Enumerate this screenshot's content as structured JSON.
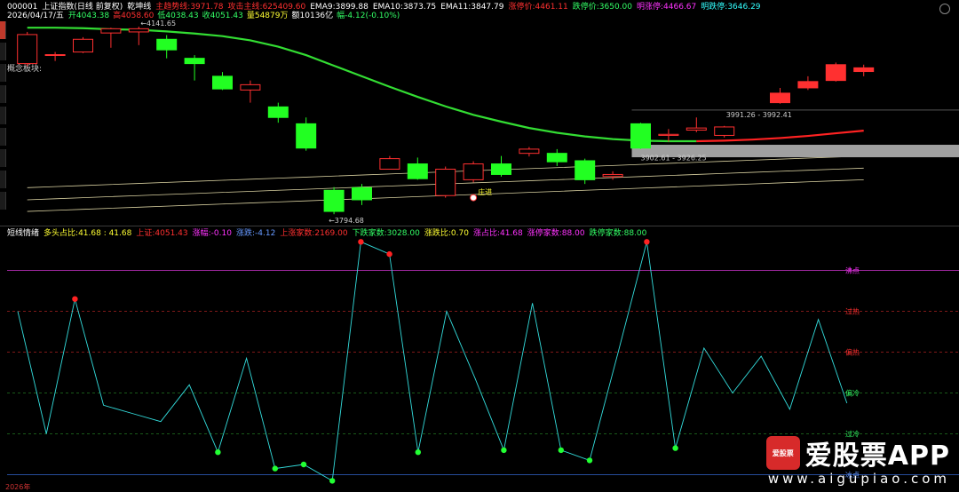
{
  "header": {
    "code": "000001",
    "name": "上证指数(日线 前复权)",
    "indicator": "乾坤线",
    "items": [
      {
        "label": "主趋势线:",
        "value": "3971.78",
        "color": "#ff3030"
      },
      {
        "label": "攻击主线:",
        "value": "625409.60",
        "color": "#ff3030"
      },
      {
        "label": "EMA9:",
        "value": "3899.88",
        "color": "#ffffff"
      },
      {
        "label": "EMA10:",
        "value": "3873.75",
        "color": "#ffffff"
      },
      {
        "label": "EMA11:",
        "value": "3847.79",
        "color": "#ffffff"
      },
      {
        "label": "涨停价:",
        "value": "4461.11",
        "color": "#ff3030"
      },
      {
        "label": "跌停价:",
        "value": "3650.00",
        "color": "#33ff66"
      },
      {
        "label": "明涨停:",
        "value": "4466.67",
        "color": "#ff33ff"
      },
      {
        "label": "明跌停:",
        "value": "3646.29",
        "color": "#33ffff"
      }
    ]
  },
  "info_line": {
    "date": "2026/04/17/五",
    "items": [
      {
        "label": "开",
        "value": "4043.38",
        "color": "#33ff66"
      },
      {
        "label": "高",
        "value": "4058.60",
        "color": "#ff3030"
      },
      {
        "label": "低",
        "value": "4038.43",
        "color": "#33ff66"
      },
      {
        "label": "收",
        "value": "4051.43",
        "color": "#33ff66"
      },
      {
        "label": "量",
        "value": "54879万",
        "color": "#ffff33"
      },
      {
        "label": "额",
        "value": "10136亿",
        "color": "#ffffff"
      },
      {
        "label": "幅",
        "value": "-4.12(-0.10%)",
        "color": "#33ff66"
      }
    ]
  },
  "main_chart": {
    "concept_label": "概念板块:",
    "annotations": {
      "high": "4141.65",
      "low": "3794.68",
      "zhuang": "庄进",
      "band_upper": "3991.26 - 3992.41",
      "band_lower": "3902.61 - 3926.25"
    },
    "colors": {
      "up": "#ff3030",
      "down": "#22ff22",
      "ma_green": "#33dd33",
      "ma_red": "#ff2222",
      "band": "#a0a0a0"
    }
  },
  "osc_header": {
    "title": "短线情绪",
    "items": [
      {
        "label": "多头占比:",
        "value": "41.68 : 41.68",
        "color": "#ffff33"
      },
      {
        "label": "上证:",
        "value": "4051.43",
        "color": "#ff3030"
      },
      {
        "label": "涨幅:",
        "value": "-0.10",
        "color": "#ff33ff"
      },
      {
        "label": "涨跌:",
        "value": "-4.12",
        "color": "#6699ff"
      },
      {
        "label": "上涨家数:",
        "value": "2169.00",
        "color": "#ff3030"
      },
      {
        "label": "下跌家数:",
        "value": "3028.00",
        "color": "#33ff66"
      },
      {
        "label": "涨跌比:",
        "value": "0.70",
        "color": "#ffff33"
      },
      {
        "label": "涨占比:",
        "value": "41.68",
        "color": "#ff33ff"
      },
      {
        "label": "涨停家数:",
        "value": "88.00",
        "color": "#ff33ff"
      },
      {
        "label": "跌停家数:",
        "value": "88.00",
        "color": "#33ff66"
      }
    ]
  },
  "osc_levels": [
    {
      "name": "沸点",
      "value": 100,
      "color": "#cc33cc",
      "text_color": "#ff33ff"
    },
    {
      "name": "过热",
      "value": 80,
      "color": "#aa2222",
      "text_color": "#ff3030"
    },
    {
      "name": "偏热",
      "value": 60,
      "color": "#aa2222",
      "text_color": "#ff3030"
    },
    {
      "name": "偏冷",
      "value": 40,
      "color": "#227722",
      "text_color": "#33ff66"
    },
    {
      "name": "过冷",
      "value": 20,
      "color": "#227722",
      "text_color": "#33ff66"
    },
    {
      "name": "冰点",
      "value": 0,
      "color": "#3366cc",
      "text_color": "#6699ff"
    }
  ],
  "chart_data": [
    {
      "type": "candlestick",
      "title": "000001 上证指数(日线 前复权)",
      "candles": [
        {
          "o": 4080,
          "c": 4135,
          "h": 4140,
          "l": 4075
        },
        {
          "o": 4096,
          "c": 4097,
          "h": 4102,
          "l": 4085
        },
        {
          "o": 4102,
          "c": 4126,
          "h": 4130,
          "l": 4100
        },
        {
          "o": 4138,
          "c": 4146,
          "h": 4148,
          "l": 4110
        },
        {
          "o": 4140,
          "c": 4146,
          "h": 4150,
          "l": 4115
        },
        {
          "o": 4126,
          "c": 4106,
          "h": 4134,
          "l": 4090
        },
        {
          "o": 4090,
          "c": 4080,
          "h": 4096,
          "l": 4048
        },
        {
          "o": 4056,
          "c": 4032,
          "h": 4064,
          "l": 4030
        },
        {
          "o": 4030,
          "c": 4040,
          "h": 4048,
          "l": 4006
        },
        {
          "o": 3998,
          "c": 3978,
          "h": 4006,
          "l": 3968
        },
        {
          "o": 3966,
          "c": 3920,
          "h": 3978,
          "l": 3915
        },
        {
          "o": 3840,
          "c": 3800,
          "h": 3846,
          "l": 3794.68
        },
        {
          "o": 3845,
          "c": 3822,
          "h": 3852,
          "l": 3812
        },
        {
          "o": 3880,
          "c": 3900,
          "h": 3905,
          "l": 3880
        },
        {
          "o": 3890,
          "c": 3862,
          "h": 3902,
          "l": 3860
        },
        {
          "o": 3830,
          "c": 3880,
          "h": 3885,
          "l": 3826
        },
        {
          "o": 3860,
          "c": 3890,
          "h": 3895,
          "l": 3855
        },
        {
          "o": 3890,
          "c": 3870,
          "h": 3905,
          "l": 3866
        },
        {
          "o": 3910,
          "c": 3918,
          "h": 3922,
          "l": 3904
        },
        {
          "o": 3910,
          "c": 3894,
          "h": 3918,
          "l": 3886
        },
        {
          "o": 3896,
          "c": 3860,
          "h": 3900,
          "l": 3852
        },
        {
          "o": 3866,
          "c": 3870,
          "h": 3876,
          "l": 3860
        },
        {
          "o": 3966,
          "c": 3920,
          "h": 3968,
          "l": 3918
        },
        {
          "o": 3944,
          "c": 3946,
          "h": 3956,
          "l": 3932
        },
        {
          "o": 3954,
          "c": 3958,
          "h": 3978,
          "l": 3950
        },
        {
          "o": 3944,
          "c": 3960,
          "h": 3962,
          "l": 3940
        },
        {
          "o": null,
          "c": null,
          "h": null,
          "l": null
        },
        {
          "o": 4006,
          "c": 4024,
          "h": 4034,
          "l": 4004
        },
        {
          "o": 4034,
          "c": 4046,
          "h": 4056,
          "l": 4030
        },
        {
          "o": 4048,
          "c": 4078,
          "h": 4082,
          "l": 4046
        },
        {
          "o": 4065,
          "c": 4072,
          "h": 4078,
          "l": 4056
        }
      ],
      "trend_line": {
        "green_end_index": 24,
        "values": [
          4148,
          4148,
          4147,
          4145,
          4144,
          4141,
          4137,
          4132,
          4124,
          4112,
          4096,
          4076,
          4056,
          4036,
          4017,
          3999,
          3983,
          3970,
          3958,
          3949,
          3942,
          3937,
          3934,
          3933,
          3933,
          3934,
          3936,
          3939,
          3943,
          3948,
          3953
        ]
      },
      "ema_lines": [
        {
          "name": "EMA9",
          "values": [
            3845,
            3847,
            3849,
            3851,
            3853,
            3855,
            3857,
            3859,
            3861,
            3863,
            3865,
            3867,
            3869,
            3871,
            3873,
            3875,
            3877,
            3879,
            3881,
            3883,
            3885,
            3887,
            3889,
            3891,
            3893,
            3895,
            3897,
            3899,
            3901,
            3903,
            3905
          ]
        },
        {
          "name": "EMA10",
          "values": [
            3822,
            3824,
            3826,
            3828,
            3830,
            3832,
            3834,
            3836,
            3838,
            3840,
            3842,
            3844,
            3846,
            3848,
            3850,
            3852,
            3854,
            3856,
            3858,
            3860,
            3862,
            3864,
            3866,
            3868,
            3870,
            3872,
            3874,
            3876,
            3878,
            3880,
            3882
          ]
        },
        {
          "name": "EMA11",
          "values": [
            3800,
            3802,
            3804,
            3806,
            3808,
            3810,
            3812,
            3814,
            3816,
            3818,
            3820,
            3822,
            3824,
            3826,
            3828,
            3830,
            3832,
            3834,
            3836,
            3838,
            3840,
            3842,
            3844,
            3846,
            3848,
            3850,
            3852,
            3854,
            3856,
            3858,
            3860
          ]
        }
      ],
      "y_range": [
        3790,
        4150
      ]
    },
    {
      "type": "line",
      "title": "短线情绪",
      "x": [
        1,
        2,
        3,
        4,
        5,
        6,
        7,
        8,
        9,
        10,
        11,
        12,
        13,
        14,
        15,
        16,
        17,
        18,
        19,
        20,
        21,
        22,
        23,
        24,
        25,
        26,
        27,
        28,
        29,
        30,
        31
      ],
      "values": [
        80,
        20,
        86,
        34,
        30,
        26,
        44,
        11,
        57,
        3,
        5,
        -3,
        114,
        108,
        11,
        80,
        47,
        12,
        84,
        12,
        7,
        60,
        114,
        13,
        62,
        40,
        58,
        32,
        76,
        35
      ],
      "ylim": [
        -5,
        115
      ],
      "level_values": [
        100,
        80,
        60,
        40,
        20,
        0
      ]
    }
  ],
  "watermark": {
    "logo_text": "爱股票",
    "title": "爱股票APP",
    "url": "www.aigupiao.com"
  },
  "bottom_date": "2026年"
}
